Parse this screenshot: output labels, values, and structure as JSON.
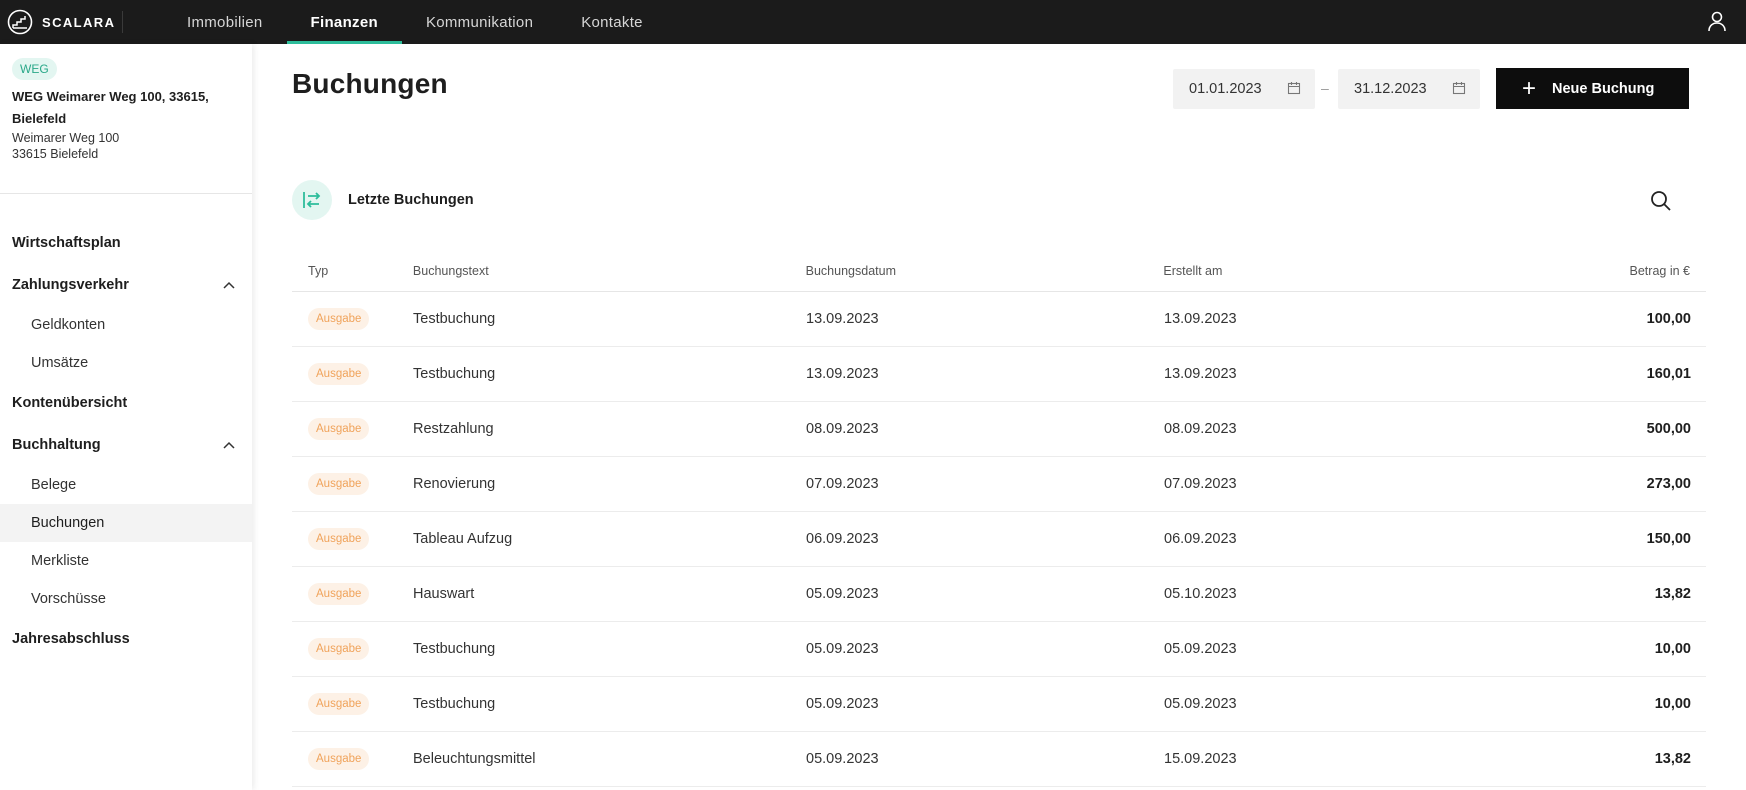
{
  "brand": {
    "name": "SCALARA"
  },
  "nav": [
    {
      "label": "Immobilien",
      "active": false
    },
    {
      "label": "Finanzen",
      "active": true
    },
    {
      "label": "Kommunikation",
      "active": false
    },
    {
      "label": "Kontakte",
      "active": false
    }
  ],
  "property": {
    "badge": "WEG",
    "title": "WEG Weimarer Weg 100, 33615, Bielefeld",
    "street": "Weimarer Weg 100",
    "city": "33615 Bielefeld"
  },
  "sidebar": {
    "wirtschaftsplan": "Wirtschaftsplan",
    "zahlungsverkehr": "Zahlungsverkehr",
    "geldkonten": "Geldkonten",
    "umsaetze": "Umsätze",
    "kontenuebersicht": "Kontenübersicht",
    "buchhaltung": "Buchhaltung",
    "belege": "Belege",
    "buchungen": "Buchungen",
    "merkliste": "Merkliste",
    "vorschuesse": "Vorschüsse",
    "jahresabschluss": "Jahresabschluss"
  },
  "page": {
    "title": "Buchungen",
    "date_from": "01.01.2023",
    "date_sep": "–",
    "date_to": "31.12.2023",
    "new_button": "Neue Buchung",
    "new_button_icon": "plus-icon",
    "section_title": "Letzte Buchungen"
  },
  "table": {
    "headers": {
      "typ": "Typ",
      "text": "Buchungstext",
      "bdate": "Buchungsdatum",
      "cdate": "Erstellt am",
      "amount": "Betrag in €"
    },
    "rows": [
      {
        "typ": "Ausgabe",
        "text": "Testbuchung",
        "bdate": "13.09.2023",
        "cdate": "13.09.2023",
        "amount": "100,00"
      },
      {
        "typ": "Ausgabe",
        "text": "Testbuchung",
        "bdate": "13.09.2023",
        "cdate": "13.09.2023",
        "amount": "160,01"
      },
      {
        "typ": "Ausgabe",
        "text": "Restzahlung",
        "bdate": "08.09.2023",
        "cdate": "08.09.2023",
        "amount": "500,00"
      },
      {
        "typ": "Ausgabe",
        "text": "Renovierung",
        "bdate": "07.09.2023",
        "cdate": "07.09.2023",
        "amount": "273,00"
      },
      {
        "typ": "Ausgabe",
        "text": "Tableau Aufzug",
        "bdate": "06.09.2023",
        "cdate": "06.09.2023",
        "amount": "150,00"
      },
      {
        "typ": "Ausgabe",
        "text": "Hauswart",
        "bdate": "05.09.2023",
        "cdate": "05.10.2023",
        "amount": "13,82"
      },
      {
        "typ": "Ausgabe",
        "text": "Testbuchung",
        "bdate": "05.09.2023",
        "cdate": "05.09.2023",
        "amount": "10,00"
      },
      {
        "typ": "Ausgabe",
        "text": "Testbuchung",
        "bdate": "05.09.2023",
        "cdate": "05.09.2023",
        "amount": "10,00"
      },
      {
        "typ": "Ausgabe",
        "text": "Beleuchtungsmittel",
        "bdate": "05.09.2023",
        "cdate": "15.09.2023",
        "amount": "13,82"
      }
    ]
  },
  "colors": {
    "accent": "#2dbd9b",
    "topbar": "#1b1b1b",
    "tag_bg": "#fdf1e6",
    "tag_text": "#f0a35b",
    "weg_badge_bg": "#e3f6f1"
  }
}
